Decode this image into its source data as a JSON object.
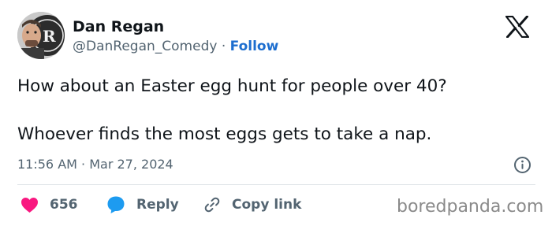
{
  "author": {
    "name": "Dan Regan",
    "handle": "@DanRegan_Comedy",
    "separator": "·",
    "follow_label": "Follow",
    "avatar_icon": "profile-photo-with-dr-logo"
  },
  "tweet": {
    "lines": [
      "How about an Easter egg hunt for people over 40?",
      "Whoever finds the most eggs gets to take a nap."
    ],
    "timestamp": "11:56 AM · Mar 27, 2024"
  },
  "actions": {
    "likes_count": "656",
    "reply_label": "Reply",
    "copy_link_label": "Copy link"
  },
  "icons": {
    "platform": "x-logo-icon",
    "info": "info-icon",
    "like": "heart-icon",
    "reply": "speech-bubble-icon",
    "copy": "link-icon"
  },
  "watermark": "boredpanda.com",
  "colors": {
    "text": "#0f1419",
    "secondary": "#536471",
    "follow_blue": "#1d6ecf",
    "heart": "#f91880",
    "reply_blue": "#1d9bf0",
    "watermark": "#8a8a8a"
  }
}
